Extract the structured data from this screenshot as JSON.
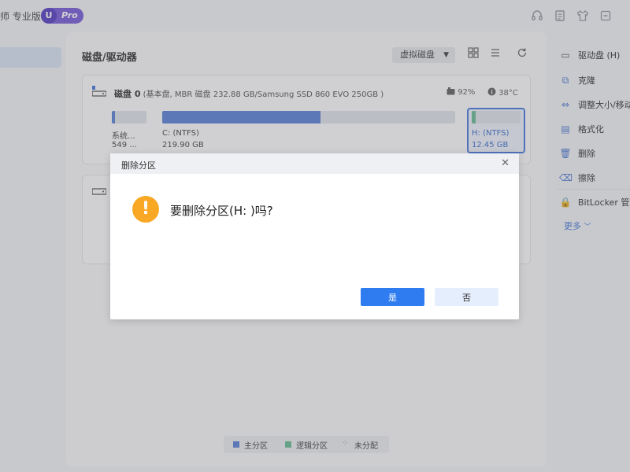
{
  "titlebar": {
    "app_name": "师 专业版",
    "badge_letter": "U",
    "badge_text": "Pro",
    "icons": [
      "headset-icon",
      "document-icon",
      "shirt-icon",
      "minimize-icon"
    ]
  },
  "main": {
    "title": "磁盘/驱动器",
    "virtual_disk_label": "虚拟磁盘",
    "view_icons": [
      "grid-view-icon",
      "list-view-icon",
      "refresh-icon"
    ]
  },
  "disk0": {
    "name": "磁盘 0",
    "info": " (基本盘, MBR 磁盘 232.88 GB/Samsung SSD 860 EVO 250GB )",
    "health": "92%",
    "temperature": "38°C",
    "partitions": [
      {
        "label": "系统...",
        "size": "549 ...",
        "fill_ratio": 0.1,
        "color": "#4f79d6"
      },
      {
        "label": "C: (NTFS)",
        "size": "219.90 GB",
        "fill_ratio": 0.54,
        "color": "#4f79d6"
      },
      {
        "label": "H: (NTFS)",
        "size": "12.45 GB",
        "fill_ratio": 0.08,
        "color": "#5cb88c"
      }
    ]
  },
  "legend": {
    "primary": "主分区",
    "logical": "逻辑分区",
    "unallocated": "未分配",
    "primary_color": "#4f79d6",
    "logical_color": "#5cb88c"
  },
  "rpanel": {
    "drive": "驱动盘 (H)",
    "actions": [
      {
        "icon": "clone-icon",
        "glyph": "⧉",
        "label": "克隆"
      },
      {
        "icon": "resize-icon",
        "glyph": "⇔",
        "label": "调整大小/移动"
      },
      {
        "icon": "format-icon",
        "glyph": "▤",
        "label": "格式化"
      },
      {
        "icon": "trash-icon",
        "glyph": "🗑",
        "label": "删除"
      },
      {
        "icon": "eraser-icon",
        "glyph": "⌫",
        "label": "擦除"
      },
      {
        "icon": "bitlocker-icon",
        "glyph": "🔒",
        "label": "BitLocker 管理"
      }
    ],
    "more": "更多"
  },
  "dialog": {
    "title": "删除分区",
    "message": "要删除分区(H: )吗?",
    "yes_label": "是",
    "no_label": "否",
    "warning_glyph": "!"
  }
}
